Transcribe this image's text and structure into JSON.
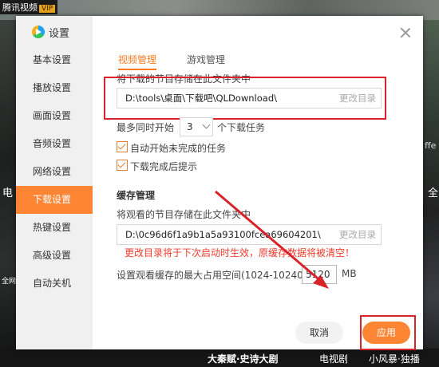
{
  "background": {
    "app_label": "腾讯视频",
    "vip": "VIP",
    "left_edge_text": "电",
    "left_edge_text2": "全网",
    "right_edge_text": "ffe",
    "right_edge_text2": "全",
    "bottom_titles": [
      "大秦赋·史诗大剧",
      "电视剧",
      "小风暴·独播"
    ]
  },
  "dialog": {
    "title": "设置",
    "sidebar_items": [
      {
        "label": "基本设置",
        "active": false
      },
      {
        "label": "播放设置",
        "active": false
      },
      {
        "label": "画面设置",
        "active": false
      },
      {
        "label": "音频设置",
        "active": false
      },
      {
        "label": "网络设置",
        "active": false
      },
      {
        "label": "下载设置",
        "active": true
      },
      {
        "label": "热键设置",
        "active": false
      },
      {
        "label": "高级设置",
        "active": false
      },
      {
        "label": "自动关机",
        "active": false
      }
    ],
    "tabs": [
      {
        "label": "视频管理",
        "active": true
      },
      {
        "label": "游戏管理",
        "active": false
      }
    ],
    "download": {
      "section_label": "将下载的节目存储在此文件夹中",
      "path": "D:\\tools\\桌面\\下载吧\\QLDownload\\",
      "change_button": "更改目录",
      "concurrent_prefix": "最多同时开始",
      "concurrent_value": "3",
      "concurrent_suffix": "个下载任务",
      "auto_start_label": "自动开始未完成的任务",
      "auto_start_checked": true,
      "notify_label": "下载完成后提示",
      "notify_checked": true
    },
    "cache": {
      "title": "缓存管理",
      "section_label": "将观看的节目存储在此文件夹中",
      "path": "D:\\0c96d6f1a9b1a5a93100fcea69604201\\",
      "change_button": "更改目录",
      "warning": "更改目录将于下次启动时生效，原缓存数据将被清空！",
      "max_label": "设置观看缓存的最大占用空间(1024-10240)",
      "max_value": "5120",
      "unit": "MB"
    },
    "buttons": {
      "cancel": "取消",
      "apply": "应用"
    },
    "accent_color": "#fe8534",
    "highlight_color": "#d9232a"
  }
}
